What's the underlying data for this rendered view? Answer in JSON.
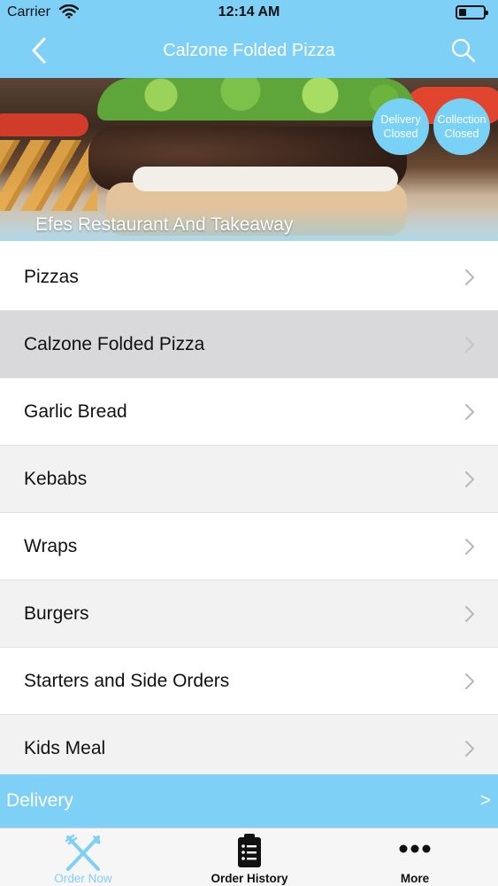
{
  "status_bar": {
    "carrier": "Carrier",
    "time": "12:14 AM",
    "icons": [
      "wifi-icon",
      "battery-icon"
    ]
  },
  "nav": {
    "title": "Calzone Folded Pizza",
    "back_icon": "chevron-left-icon",
    "search_icon": "search-icon"
  },
  "banner": {
    "restaurant_name": "Efes Restaurant And Takeaway",
    "delivery_status": [
      "Delivery",
      "Closed"
    ],
    "collection_status": [
      "Collection",
      "Closed"
    ]
  },
  "categories": [
    {
      "label": "Pizzas",
      "selected": false
    },
    {
      "label": "Calzone Folded Pizza",
      "selected": true
    },
    {
      "label": "Garlic Bread",
      "selected": false
    },
    {
      "label": "Kebabs",
      "selected": false
    },
    {
      "label": "Wraps",
      "selected": false
    },
    {
      "label": "Burgers",
      "selected": false
    },
    {
      "label": "Starters and Side Orders",
      "selected": false
    },
    {
      "label": "Kids Meal",
      "selected": false
    }
  ],
  "delivery_bar": {
    "label": "Delivery",
    "arrow": ">"
  },
  "tabs": [
    {
      "label": "Order Now",
      "icon": "fork-knife-icon",
      "active": true
    },
    {
      "label": "Order History",
      "icon": "clipboard-list-icon",
      "active": false
    },
    {
      "label": "More",
      "icon": "more-dots-icon",
      "active": false
    }
  ],
  "colors": {
    "accent": "#7fd0f6",
    "selected_row": "#d9d9db",
    "alt_row": "#f2f2f3"
  }
}
